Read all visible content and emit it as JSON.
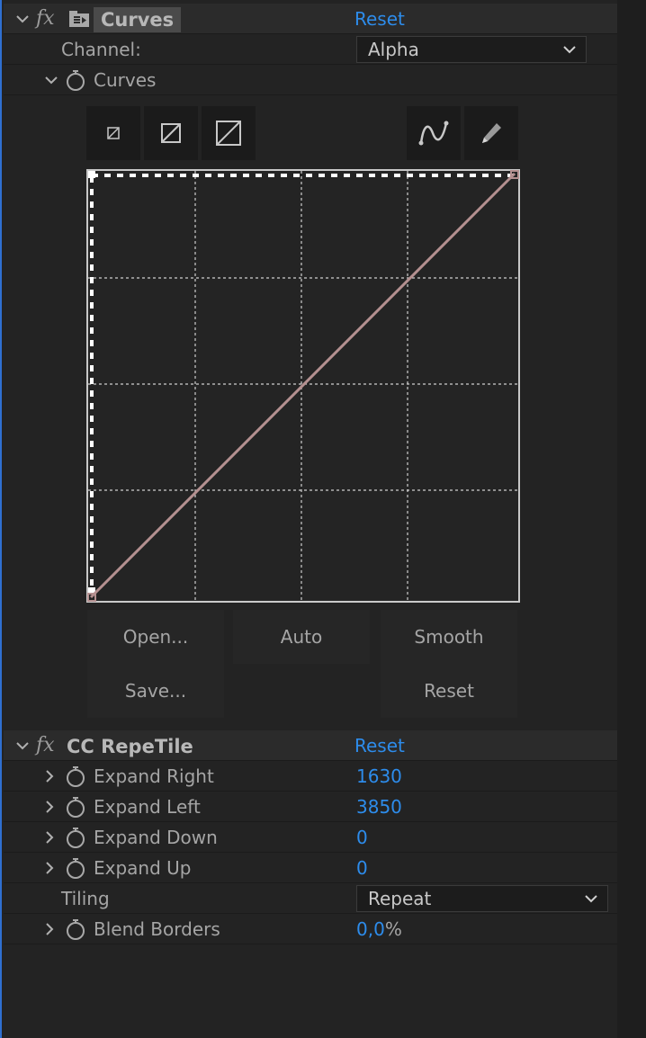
{
  "curves_effect": {
    "name": "Curves",
    "reset_label": "Reset",
    "channel_label": "Channel:",
    "channel_value": "Alpha",
    "curves_param_label": "Curves",
    "tools": [
      "small-graph-icon",
      "medium-graph-icon",
      "large-graph-icon",
      "bezier-tool-icon",
      "pencil-tool-icon"
    ],
    "buttons": {
      "open": "Open...",
      "auto": "Auto",
      "smooth": "Smooth",
      "save": "Save...",
      "reset": "Reset"
    },
    "curve_color": "#b49090"
  },
  "repetile_effect": {
    "name": "CC RepeTile",
    "reset_label": "Reset",
    "params": [
      {
        "label": "Expand Right",
        "value": "1630"
      },
      {
        "label": "Expand Left",
        "value": "3850"
      },
      {
        "label": "Expand Down",
        "value": "0"
      },
      {
        "label": "Expand Up",
        "value": "0"
      }
    ],
    "tiling_label": "Tiling",
    "tiling_value": "Repeat",
    "blend_borders_label": "Blend Borders",
    "blend_borders_value": "0,0",
    "blend_borders_unit": "%"
  },
  "colors": {
    "accent": "#2d8ceb",
    "panel": "#232323"
  }
}
